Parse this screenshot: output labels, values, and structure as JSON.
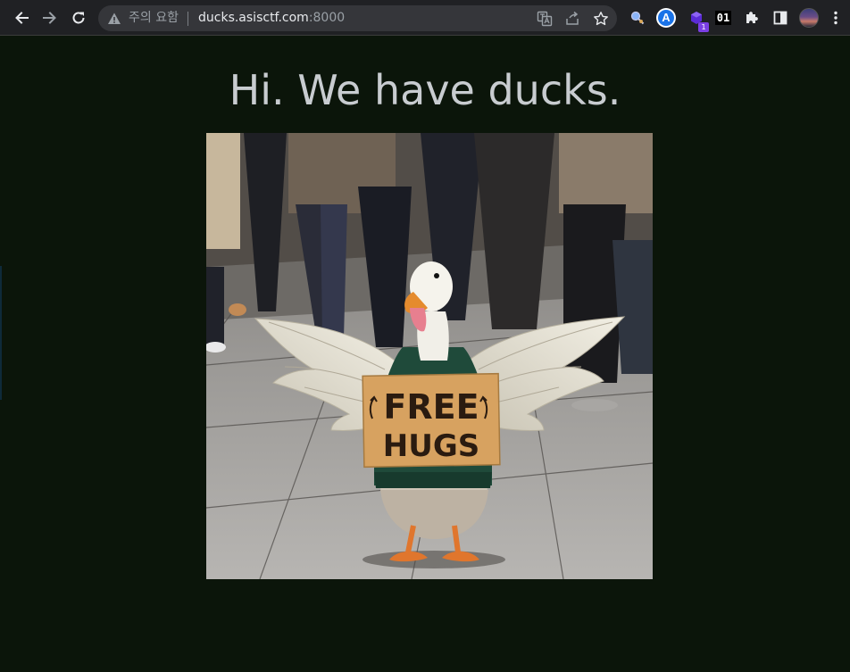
{
  "browser": {
    "security_warning": "주의 요함",
    "url_host": "ducks.asisctf.com",
    "url_port": ":8000",
    "extension_badge": "1",
    "extension_01": "01",
    "extension_a": "A"
  },
  "page": {
    "heading": "Hi. We have ducks."
  },
  "image": {
    "sign_line1": "FREE",
    "sign_line2": "HUGS"
  },
  "colors": {
    "background": "#0b150a",
    "heading": "#c8ccd0",
    "toolbar": "#202124"
  }
}
